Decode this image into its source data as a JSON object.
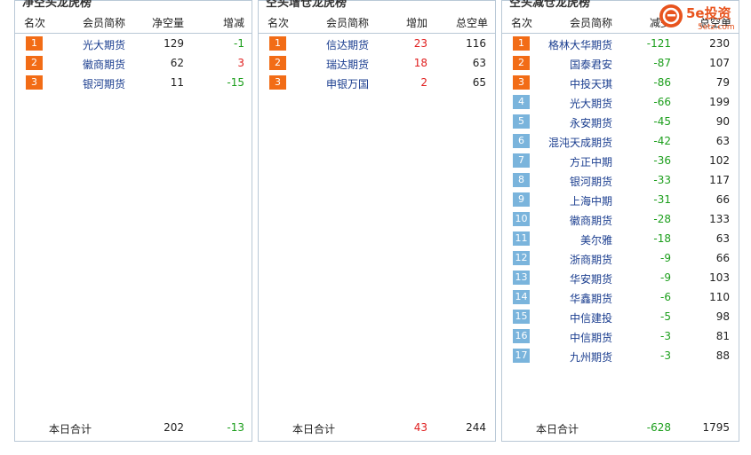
{
  "panels": [
    {
      "title": "净空头龙虎榜",
      "headers": [
        "名次",
        "会员简称",
        "净空量",
        "增减"
      ],
      "rows": [
        {
          "rank": "1",
          "name": "光大期货",
          "v1": "129",
          "v2": "-1"
        },
        {
          "rank": "2",
          "name": "徽商期货",
          "v1": "62",
          "v2": "3"
        },
        {
          "rank": "3",
          "name": "银河期货",
          "v1": "11",
          "v2": "-15"
        }
      ],
      "total": {
        "label": "本日合计",
        "v1": "202",
        "v2": "-13"
      }
    },
    {
      "title": "空头增仓龙虎榜",
      "headers": [
        "名次",
        "会员简称",
        "增加",
        "总空单"
      ],
      "rows": [
        {
          "rank": "1",
          "name": "信达期货",
          "v1": "23",
          "v2": "116"
        },
        {
          "rank": "2",
          "name": "瑞达期货",
          "v1": "18",
          "v2": "63"
        },
        {
          "rank": "3",
          "name": "申银万国",
          "v1": "2",
          "v2": "65"
        }
      ],
      "total": {
        "label": "本日合计",
        "v1": "43",
        "v2": "244"
      }
    },
    {
      "title": "空头减仓龙虎榜",
      "headers": [
        "名次",
        "会员简称",
        "减少",
        "总空单"
      ],
      "rows": [
        {
          "rank": "1",
          "name": "格林大华期货",
          "v1": "-121",
          "v2": "230"
        },
        {
          "rank": "2",
          "name": "国泰君安",
          "v1": "-87",
          "v2": "107"
        },
        {
          "rank": "3",
          "name": "中投天琪",
          "v1": "-86",
          "v2": "79"
        },
        {
          "rank": "4",
          "name": "光大期货",
          "v1": "-66",
          "v2": "199"
        },
        {
          "rank": "5",
          "name": "永安期货",
          "v1": "-45",
          "v2": "90"
        },
        {
          "rank": "6",
          "name": "混沌天成期货",
          "v1": "-42",
          "v2": "63"
        },
        {
          "rank": "7",
          "name": "方正中期",
          "v1": "-36",
          "v2": "102"
        },
        {
          "rank": "8",
          "name": "银河期货",
          "v1": "-33",
          "v2": "117"
        },
        {
          "rank": "9",
          "name": "上海中期",
          "v1": "-31",
          "v2": "66"
        },
        {
          "rank": "10",
          "name": "徽商期货",
          "v1": "-28",
          "v2": "133"
        },
        {
          "rank": "11",
          "name": "美尔雅",
          "v1": "-18",
          "v2": "63"
        },
        {
          "rank": "12",
          "name": "浙商期货",
          "v1": "-9",
          "v2": "66"
        },
        {
          "rank": "13",
          "name": "华安期货",
          "v1": "-9",
          "v2": "103"
        },
        {
          "rank": "14",
          "name": "华鑫期货",
          "v1": "-6",
          "v2": "110"
        },
        {
          "rank": "15",
          "name": "中信建投",
          "v1": "-5",
          "v2": "98"
        },
        {
          "rank": "16",
          "name": "中信期货",
          "v1": "-3",
          "v2": "81"
        },
        {
          "rank": "17",
          "name": "九州期货",
          "v1": "-3",
          "v2": "88"
        }
      ],
      "total": {
        "label": "本日合计",
        "v1": "-628",
        "v2": "1795"
      }
    }
  ],
  "logo": {
    "brand": "5e投资",
    "site": "5etz.com"
  },
  "colors": {
    "top_rank": "#f26c16",
    "rank": "#7ab4dc",
    "up": "#e02020",
    "down": "#1b9e1b",
    "name": "#1a3d8f"
  }
}
